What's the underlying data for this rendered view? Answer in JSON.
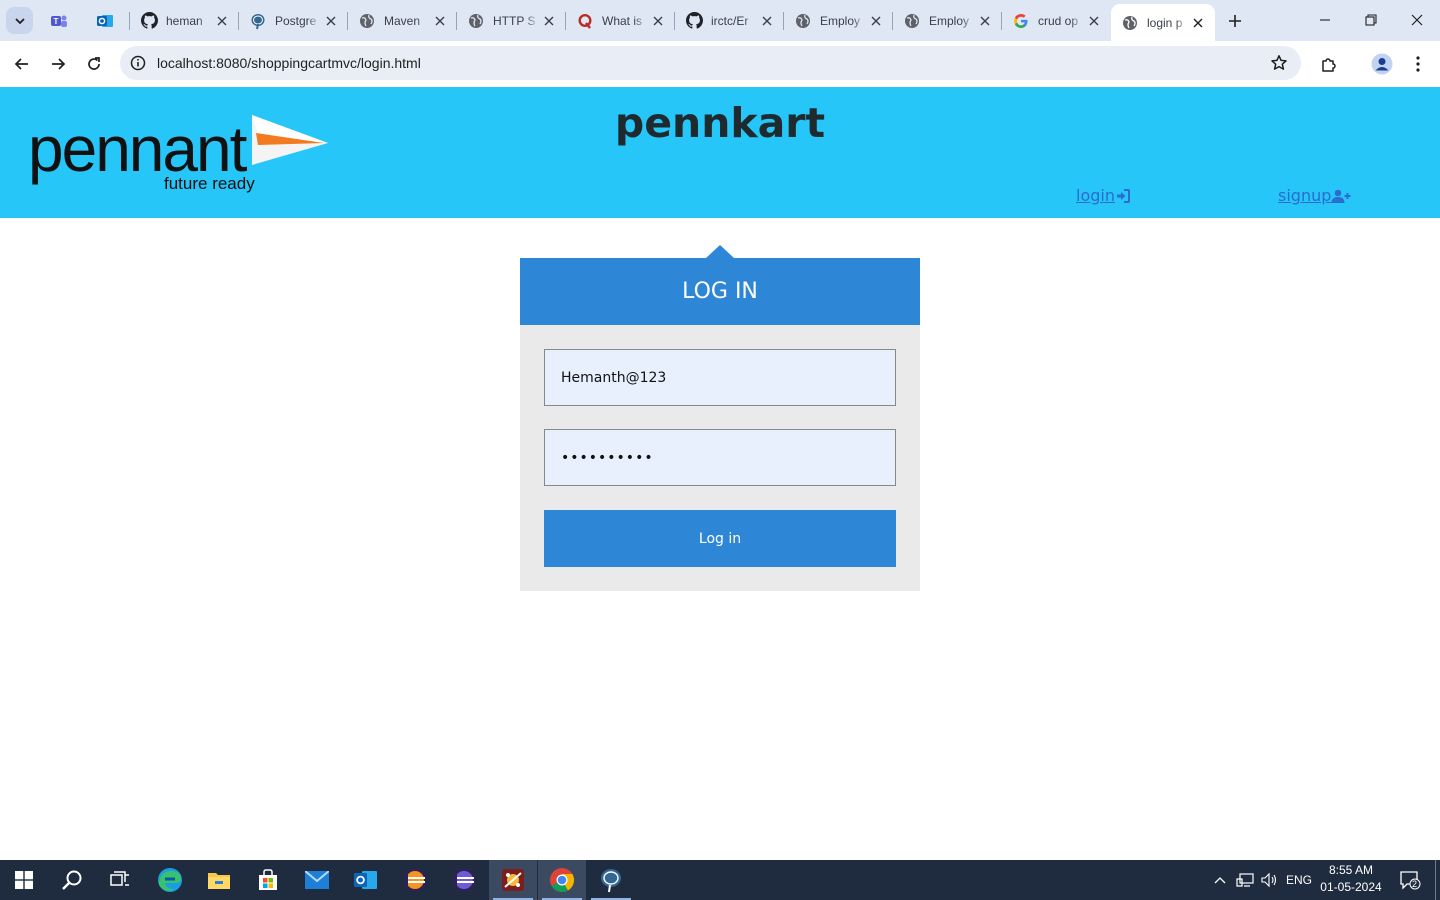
{
  "browser": {
    "tabs": [
      {
        "title": "",
        "icon": "teams-icon"
      },
      {
        "title": "",
        "icon": "outlook-icon"
      },
      {
        "title": "heman",
        "icon": "github-icon"
      },
      {
        "title": "Postgre",
        "icon": "postgresql-icon"
      },
      {
        "title": "Maven",
        "icon": "globe-icon"
      },
      {
        "title": "HTTP S",
        "icon": "globe-icon"
      },
      {
        "title": "What is",
        "icon": "quora-icon"
      },
      {
        "title": "irctc/Er",
        "icon": "github-icon"
      },
      {
        "title": "Employ",
        "icon": "globe-icon"
      },
      {
        "title": "Employ",
        "icon": "globe-icon"
      },
      {
        "title": "crud op",
        "icon": "google-icon"
      },
      {
        "title": "login p",
        "icon": "globe-icon",
        "active": true
      }
    ],
    "url": "localhost:8080/shoppingcartmvc/login.html"
  },
  "page": {
    "logo": {
      "name": "pennant",
      "tagline": "future ready"
    },
    "site_title": "pennkart",
    "nav": {
      "login_label": "login",
      "signup_label": "signup"
    },
    "login": {
      "heading": "LOG IN",
      "username_value": "Hemanth@123",
      "password_value": "••••••••••",
      "button_label": "Log in"
    },
    "colors": {
      "header_bg": "#26c6f9",
      "accent": "#2e86d6",
      "panel_bg": "#eaeaea",
      "field_bg": "#e8f0fe"
    }
  },
  "taskbar": {
    "apps": [
      "start",
      "search",
      "task-view",
      "edge",
      "file-explorer",
      "store",
      "mail",
      "outlook",
      "eclipse",
      "eclipse",
      "hearts-game",
      "chrome",
      "postgresql"
    ],
    "language": "ENG",
    "time": "8:55 AM",
    "date": "01-05-2024",
    "notifications": "2"
  }
}
